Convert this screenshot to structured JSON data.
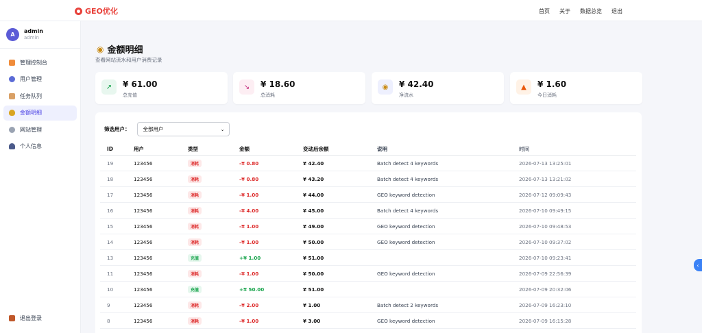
{
  "header": {
    "logo_text": "GEO优化",
    "nav": [
      "首页",
      "关于",
      "数据总览",
      "退出"
    ]
  },
  "user": {
    "initial": "A",
    "name": "admin",
    "role": "admin"
  },
  "sidebar": {
    "items": [
      {
        "label": "管理控制台",
        "icon": "dashboard-icon",
        "active": false
      },
      {
        "label": "用户管理",
        "icon": "users-icon",
        "active": false
      },
      {
        "label": "任务队列",
        "icon": "clipboard-icon",
        "active": false
      },
      {
        "label": "金额明细",
        "icon": "money-bag-icon",
        "active": true
      },
      {
        "label": "网站管理",
        "icon": "gear-icon",
        "active": false
      },
      {
        "label": "个人信息",
        "icon": "person-icon",
        "active": false
      }
    ],
    "logout_label": "退出登录"
  },
  "page": {
    "title": "金额明细",
    "subtitle": "查看网站流水和用户消费记录"
  },
  "stats": [
    {
      "value": "¥ 61.00",
      "label": "总充值",
      "icon": "chart-up-icon",
      "color": "#e8f7ef"
    },
    {
      "value": "¥ 18.60",
      "label": "总消耗",
      "icon": "chart-down-icon",
      "color": "#fdeef3"
    },
    {
      "value": "¥ 42.40",
      "label": "净流水",
      "icon": "money-bag-icon",
      "color": "#eef0fe"
    },
    {
      "value": "¥ 1.60",
      "label": "今日消耗",
      "icon": "fire-icon",
      "color": "#fff2e6"
    }
  ],
  "filter": {
    "label": "筛选用户：",
    "selected": "全部用户"
  },
  "table": {
    "headers": [
      "ID",
      "用户",
      "类型",
      "金额",
      "变动后余额",
      "说明",
      "时间"
    ],
    "rows": [
      {
        "id": "19",
        "user": "123456",
        "type": "消耗",
        "kind": "spend",
        "amount": "-¥ 0.80",
        "balance": "¥ 42.40",
        "desc": "Batch detect 4 keywords",
        "time": "2026-07-13 13:25:01"
      },
      {
        "id": "18",
        "user": "123456",
        "type": "消耗",
        "kind": "spend",
        "amount": "-¥ 0.80",
        "balance": "¥ 43.20",
        "desc": "Batch detect 4 keywords",
        "time": "2026-07-13 13:21:02"
      },
      {
        "id": "17",
        "user": "123456",
        "type": "消耗",
        "kind": "spend",
        "amount": "-¥ 1.00",
        "balance": "¥ 44.00",
        "desc": "GEO keyword detection",
        "time": "2026-07-12 09:09:43"
      },
      {
        "id": "16",
        "user": "123456",
        "type": "消耗",
        "kind": "spend",
        "amount": "-¥ 4.00",
        "balance": "¥ 45.00",
        "desc": "Batch detect 4 keywords",
        "time": "2026-07-10 09:49:15"
      },
      {
        "id": "15",
        "user": "123456",
        "type": "消耗",
        "kind": "spend",
        "amount": "-¥ 1.00",
        "balance": "¥ 49.00",
        "desc": "GEO keyword detection",
        "time": "2026-07-10 09:48:53"
      },
      {
        "id": "14",
        "user": "123456",
        "type": "消耗",
        "kind": "spend",
        "amount": "-¥ 1.00",
        "balance": "¥ 50.00",
        "desc": "GEO keyword detection",
        "time": "2026-07-10 09:37:02"
      },
      {
        "id": "13",
        "user": "123456",
        "type": "充值",
        "kind": "recharge",
        "amount": "+¥ 1.00",
        "balance": "¥ 51.00",
        "desc": "",
        "time": "2026-07-10 09:23:41"
      },
      {
        "id": "11",
        "user": "123456",
        "type": "消耗",
        "kind": "spend",
        "amount": "-¥ 1.00",
        "balance": "¥ 50.00",
        "desc": "GEO keyword detection",
        "time": "2026-07-09 22:56:39"
      },
      {
        "id": "10",
        "user": "123456",
        "type": "充值",
        "kind": "recharge",
        "amount": "+¥ 50.00",
        "balance": "¥ 51.00",
        "desc": "",
        "time": "2026-07-09 20:32:06"
      },
      {
        "id": "9",
        "user": "123456",
        "type": "消耗",
        "kind": "spend",
        "amount": "-¥ 2.00",
        "balance": "¥ 1.00",
        "desc": "Batch detect 2 keywords",
        "time": "2026-07-09 16:23:10"
      },
      {
        "id": "8",
        "user": "123456",
        "type": "消耗",
        "kind": "spend",
        "amount": "-¥ 1.00",
        "balance": "¥ 3.00",
        "desc": "GEO keyword detection",
        "time": "2026-07-09 16:15:28"
      }
    ]
  }
}
